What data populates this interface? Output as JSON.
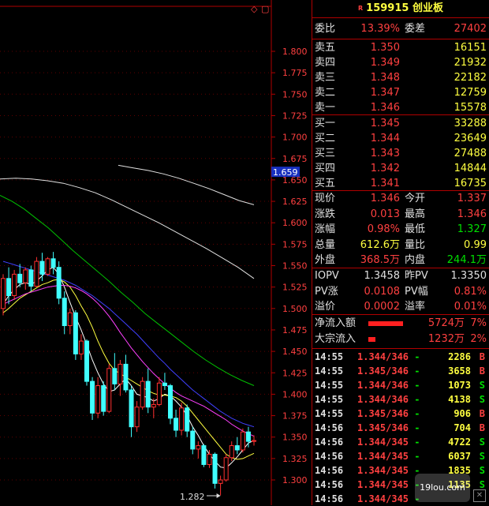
{
  "header": {
    "code": "159915",
    "name": "创业板",
    "mark": "R"
  },
  "top_icons": {
    "diamond": "◇",
    "square": "▢"
  },
  "commission": {
    "ratio_label": "委比",
    "ratio": "13.39%",
    "diff_label": "委差",
    "diff": "27402"
  },
  "sells": [
    {
      "label": "卖五",
      "price": "1.350",
      "vol": "16151"
    },
    {
      "label": "卖四",
      "price": "1.349",
      "vol": "21932"
    },
    {
      "label": "卖三",
      "price": "1.348",
      "vol": "22182"
    },
    {
      "label": "卖二",
      "price": "1.347",
      "vol": "12759"
    },
    {
      "label": "卖一",
      "price": "1.346",
      "vol": "15578"
    }
  ],
  "buys": [
    {
      "label": "买一",
      "price": "1.345",
      "vol": "33288"
    },
    {
      "label": "买二",
      "price": "1.344",
      "vol": "23649"
    },
    {
      "label": "买三",
      "price": "1.343",
      "vol": "27488"
    },
    {
      "label": "买四",
      "price": "1.342",
      "vol": "14844"
    },
    {
      "label": "买五",
      "price": "1.341",
      "vol": "16735"
    }
  ],
  "quote": [
    {
      "l1": "现价",
      "v1": "1.346",
      "l2": "今开",
      "v2": "1.337"
    },
    {
      "l1": "涨跌",
      "v1": "0.013",
      "l2": "最高",
      "v2": "1.346"
    },
    {
      "l1": "涨幅",
      "v1": "0.98%",
      "l2": "最低",
      "v2": "1.327"
    },
    {
      "l1": "总量",
      "v1": "612.6万",
      "l2": "量比",
      "v2": "0.99"
    },
    {
      "l1": "外盘",
      "v1": "368.5万",
      "l2": "内盘",
      "v2": "244.1万"
    }
  ],
  "iopv": [
    {
      "l1": "IOPV",
      "v1": "1.3458",
      "l2": "昨PV",
      "v2": "1.3350"
    },
    {
      "l1": "PV涨",
      "v1": "0.0108",
      "l2": "PV幅",
      "v2": "0.81%"
    },
    {
      "l1": "溢价",
      "v1": "0.0002",
      "l2": "溢率",
      "v2": "0.01%"
    }
  ],
  "flows": [
    {
      "label": "净流入额",
      "amount": "5724万",
      "pct": "7%",
      "bar": 0.58
    },
    {
      "label": "大宗流入",
      "amount": "1232万",
      "pct": "2%",
      "bar": 0.12
    }
  ],
  "ticks": [
    {
      "time": "14:55",
      "price": "1.344/346",
      "dir": "-",
      "vol": "2286",
      "bs": "B"
    },
    {
      "time": "14:55",
      "price": "1.345/346",
      "dir": "-",
      "vol": "3658",
      "bs": "B"
    },
    {
      "time": "14:55",
      "price": "1.344/346",
      "dir": "-",
      "vol": "1073",
      "bs": "S"
    },
    {
      "time": "14:55",
      "price": "1.344/346",
      "dir": "-",
      "vol": "4138",
      "bs": "S"
    },
    {
      "time": "14:55",
      "price": "1.345/346",
      "dir": "-",
      "vol": "906",
      "bs": "B"
    },
    {
      "time": "14:56",
      "price": "1.345/346",
      "dir": "-",
      "vol": "704",
      "bs": "B"
    },
    {
      "time": "14:56",
      "price": "1.344/345",
      "dir": "-",
      "vol": "4722",
      "bs": "S"
    },
    {
      "time": "14:56",
      "price": "1.344/345",
      "dir": "-",
      "vol": "6037",
      "bs": "S"
    },
    {
      "time": "14:56",
      "price": "1.344/345",
      "dir": "-",
      "vol": "1835",
      "bs": "S"
    },
    {
      "time": "14:56",
      "price": "1.344/345",
      "dir": "-",
      "vol": "1135",
      "bs": "S"
    },
    {
      "time": "14:56",
      "price": "1.344/345",
      "dir": "-",
      "vol": "",
      "bs": ""
    }
  ],
  "watermark": {
    "text": "19lou.com"
  },
  "chart_data": {
    "type": "candlestick",
    "ylim": [
      1.275,
      1.82
    ],
    "y_ticks": [
      "1.800",
      "1.775",
      "1.750",
      "1.725",
      "1.700",
      "1.675",
      "1.650",
      "1.625",
      "1.600",
      "1.575",
      "1.550",
      "1.525",
      "1.500",
      "1.475",
      "1.450",
      "1.425",
      "1.400",
      "1.375",
      "1.350",
      "1.325",
      "1.300"
    ],
    "current_price_label": "1.659",
    "current_price": 1.659,
    "low_annotation": "1.282",
    "low_value": 1.282,
    "colors": {
      "up": "#ff3030",
      "down": "#40ffff",
      "ma5": "#ffffff",
      "ma10": "#ffff40",
      "ma20": "#ff40ff",
      "ma30": "#4040ff",
      "ma60": "#00c000",
      "ma120": "#e0e0e0",
      "ma250": "#e0e0e0"
    },
    "candles": [
      {
        "o": 1.5,
        "h": 1.54,
        "l": 1.492,
        "c": 1.535
      },
      {
        "o": 1.535,
        "h": 1.548,
        "l": 1.505,
        "c": 1.515
      },
      {
        "o": 1.515,
        "h": 1.545,
        "l": 1.51,
        "c": 1.54
      },
      {
        "o": 1.54,
        "h": 1.552,
        "l": 1.525,
        "c": 1.53
      },
      {
        "o": 1.53,
        "h": 1.548,
        "l": 1.522,
        "c": 1.545
      },
      {
        "o": 1.545,
        "h": 1.55,
        "l": 1.52,
        "c": 1.526
      },
      {
        "o": 1.526,
        "h": 1.56,
        "l": 1.525,
        "c": 1.555
      },
      {
        "o": 1.555,
        "h": 1.565,
        "l": 1.532,
        "c": 1.54
      },
      {
        "o": 1.54,
        "h": 1.56,
        "l": 1.538,
        "c": 1.558
      },
      {
        "o": 1.558,
        "h": 1.566,
        "l": 1.54,
        "c": 1.548
      },
      {
        "o": 1.548,
        "h": 1.555,
        "l": 1.505,
        "c": 1.512
      },
      {
        "o": 1.512,
        "h": 1.52,
        "l": 1.47,
        "c": 1.48
      },
      {
        "o": 1.48,
        "h": 1.5,
        "l": 1.47,
        "c": 1.495
      },
      {
        "o": 1.495,
        "h": 1.498,
        "l": 1.44,
        "c": 1.447
      },
      {
        "o": 1.447,
        "h": 1.47,
        "l": 1.44,
        "c": 1.462
      },
      {
        "o": 1.462,
        "h": 1.464,
        "l": 1.41,
        "c": 1.415
      },
      {
        "o": 1.415,
        "h": 1.42,
        "l": 1.37,
        "c": 1.378
      },
      {
        "o": 1.378,
        "h": 1.42,
        "l": 1.372,
        "c": 1.41
      },
      {
        "o": 1.41,
        "h": 1.415,
        "l": 1.375,
        "c": 1.38
      },
      {
        "o": 1.38,
        "h": 1.435,
        "l": 1.378,
        "c": 1.43
      },
      {
        "o": 1.43,
        "h": 1.448,
        "l": 1.405,
        "c": 1.412
      },
      {
        "o": 1.412,
        "h": 1.44,
        "l": 1.398,
        "c": 1.435
      },
      {
        "o": 1.435,
        "h": 1.446,
        "l": 1.402,
        "c": 1.405
      },
      {
        "o": 1.405,
        "h": 1.41,
        "l": 1.35,
        "c": 1.362
      },
      {
        "o": 1.362,
        "h": 1.392,
        "l": 1.356,
        "c": 1.385
      },
      {
        "o": 1.385,
        "h": 1.42,
        "l": 1.382,
        "c": 1.415
      },
      {
        "o": 1.415,
        "h": 1.43,
        "l": 1.378,
        "c": 1.385
      },
      {
        "o": 1.385,
        "h": 1.395,
        "l": 1.372,
        "c": 1.388
      },
      {
        "o": 1.388,
        "h": 1.42,
        "l": 1.386,
        "c": 1.413
      },
      {
        "o": 1.413,
        "h": 1.425,
        "l": 1.405,
        "c": 1.41
      },
      {
        "o": 1.41,
        "h": 1.412,
        "l": 1.365,
        "c": 1.372
      },
      {
        "o": 1.372,
        "h": 1.382,
        "l": 1.35,
        "c": 1.358
      },
      {
        "o": 1.358,
        "h": 1.39,
        "l": 1.352,
        "c": 1.384
      },
      {
        "o": 1.384,
        "h": 1.388,
        "l": 1.35,
        "c": 1.357
      },
      {
        "o": 1.357,
        "h": 1.362,
        "l": 1.33,
        "c": 1.336
      },
      {
        "o": 1.336,
        "h": 1.345,
        "l": 1.325,
        "c": 1.34
      },
      {
        "o": 1.34,
        "h": 1.342,
        "l": 1.315,
        "c": 1.318
      },
      {
        "o": 1.318,
        "h": 1.335,
        "l": 1.314,
        "c": 1.33
      },
      {
        "o": 1.33,
        "h": 1.332,
        "l": 1.29,
        "c": 1.296
      },
      {
        "o": 1.296,
        "h": 1.305,
        "l": 1.282,
        "c": 1.3
      },
      {
        "o": 1.3,
        "h": 1.33,
        "l": 1.298,
        "c": 1.326
      },
      {
        "o": 1.326,
        "h": 1.345,
        "l": 1.322,
        "c": 1.34
      },
      {
        "o": 1.34,
        "h": 1.35,
        "l": 1.33,
        "c": 1.335
      },
      {
        "o": 1.335,
        "h": 1.36,
        "l": 1.332,
        "c": 1.356
      },
      {
        "o": 1.356,
        "h": 1.362,
        "l": 1.338,
        "c": 1.345
      },
      {
        "o": 1.345,
        "h": 1.352,
        "l": 1.34,
        "c": 1.346
      }
    ],
    "ma5": [
      1.505,
      1.515,
      1.522,
      1.528,
      1.53,
      1.528,
      1.532,
      1.538,
      1.545,
      1.548,
      1.54,
      1.525,
      1.507,
      1.49,
      1.475,
      1.458,
      1.44,
      1.425,
      1.412,
      1.403,
      1.405,
      1.412,
      1.418,
      1.41,
      1.4,
      1.398,
      1.396,
      1.392,
      1.395,
      1.4,
      1.398,
      1.392,
      1.385,
      1.375,
      1.362,
      1.352,
      1.34,
      1.33,
      1.322,
      1.315,
      1.314,
      1.32,
      1.327,
      1.335,
      1.343,
      1.346
    ],
    "ma10": [
      1.495,
      1.5,
      1.506,
      1.512,
      1.516,
      1.52,
      1.524,
      1.528,
      1.53,
      1.533,
      1.534,
      1.531,
      1.525,
      1.515,
      1.503,
      1.492,
      1.478,
      1.462,
      1.448,
      1.436,
      1.428,
      1.424,
      1.42,
      1.416,
      1.412,
      1.408,
      1.404,
      1.401,
      1.399,
      1.399,
      1.398,
      1.396,
      1.392,
      1.386,
      1.378,
      1.37,
      1.362,
      1.354,
      1.346,
      1.338,
      1.33,
      1.326,
      1.324,
      1.325,
      1.328,
      1.331
    ],
    "ma20": [
      1.505,
      1.508,
      1.511,
      1.514,
      1.517,
      1.519,
      1.521,
      1.523,
      1.525,
      1.526,
      1.527,
      1.527,
      1.526,
      1.524,
      1.521,
      1.517,
      1.512,
      1.506,
      1.499,
      1.491,
      1.482,
      1.472,
      1.463,
      1.454,
      1.446,
      1.438,
      1.431,
      1.424,
      1.418,
      1.412,
      1.407,
      1.402,
      1.398,
      1.395,
      1.392,
      1.389,
      1.386,
      1.382,
      1.378,
      1.374,
      1.37,
      1.365,
      1.361,
      1.357,
      1.354,
      1.351
    ],
    "ma30": [
      1.555,
      1.553,
      1.551,
      1.549,
      1.547,
      1.545,
      1.543,
      1.541,
      1.539,
      1.537,
      1.535,
      1.533,
      1.53,
      1.527,
      1.523,
      1.519,
      1.515,
      1.51,
      1.505,
      1.5,
      1.494,
      1.488,
      1.482,
      1.476,
      1.47,
      1.463,
      1.456,
      1.449,
      1.442,
      1.436,
      1.429,
      1.423,
      1.417,
      1.411,
      1.405,
      1.4,
      1.395,
      1.39,
      1.385,
      1.38,
      1.376,
      1.372,
      1.369,
      1.366,
      1.364,
      1.362
    ]
  },
  "ma_long": {
    "ma60": [
      1.632,
      1.625,
      1.616,
      1.605,
      1.594,
      1.581,
      1.568,
      1.556,
      1.544,
      1.532,
      1.519,
      1.507,
      1.494,
      1.483,
      1.472,
      1.461,
      1.45,
      1.44,
      1.431,
      1.423,
      1.416,
      1.41
    ],
    "ma120": [
      1.651,
      1.652,
      1.651,
      1.649,
      1.646,
      1.641,
      1.635,
      1.627,
      1.618,
      1.609,
      1.6,
      1.59,
      1.58,
      1.57,
      1.559,
      1.548,
      1.535
    ],
    "ma250": [
      1.667,
      1.664,
      1.661,
      1.657,
      1.652,
      1.646,
      1.64,
      1.633,
      1.626,
      1.621
    ]
  }
}
